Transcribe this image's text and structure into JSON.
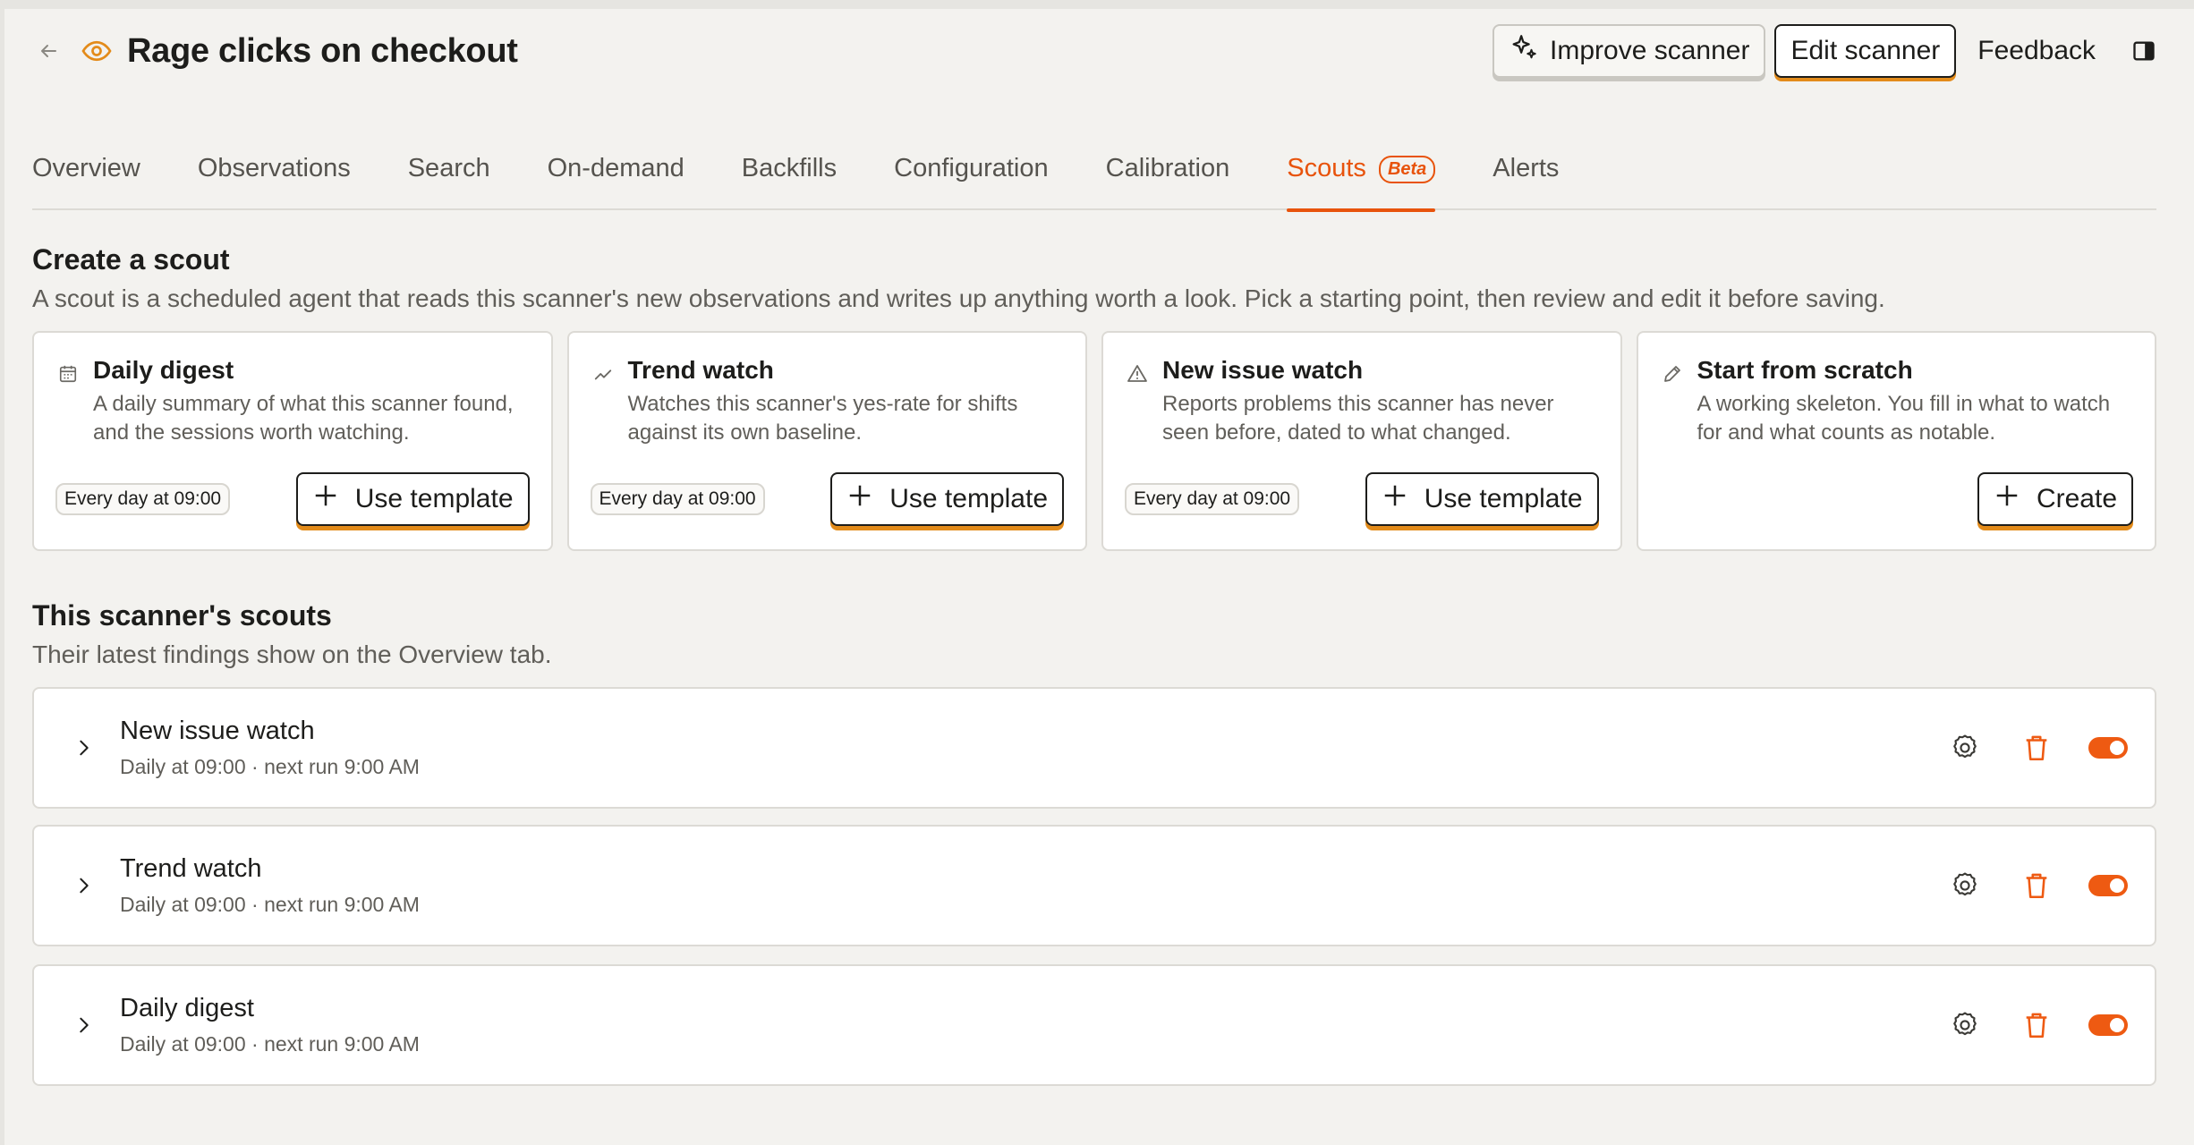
{
  "header": {
    "title": "Rage clicks on checkout",
    "improve_label": "Improve scanner",
    "edit_label": "Edit scanner",
    "feedback_label": "Feedback"
  },
  "tabs": [
    {
      "label": "Overview"
    },
    {
      "label": "Observations"
    },
    {
      "label": "Search"
    },
    {
      "label": "On-demand"
    },
    {
      "label": "Backfills"
    },
    {
      "label": "Configuration"
    },
    {
      "label": "Calibration"
    },
    {
      "label": "Scouts",
      "badge": "Beta",
      "active": true
    },
    {
      "label": "Alerts"
    }
  ],
  "create": {
    "title": "Create a scout",
    "description": "A scout is a scheduled agent that reads this scanner's new observations and writes up anything worth a look. Pick a starting point, then review and edit it before saving.",
    "templates": [
      {
        "icon": "calendar-icon",
        "title": "Daily digest",
        "desc": "A daily summary of what this scanner found, and the sessions worth watching.",
        "schedule": "Every day at 09:00",
        "button": "Use template"
      },
      {
        "icon": "trend-icon",
        "title": "Trend watch",
        "desc": "Watches this scanner's yes-rate for shifts against its own baseline.",
        "schedule": "Every day at 09:00",
        "button": "Use template"
      },
      {
        "icon": "warning-icon",
        "title": "New issue watch",
        "desc": "Reports problems this scanner has never seen before, dated to what changed.",
        "schedule": "Every day at 09:00",
        "button": "Use template"
      },
      {
        "icon": "pencil-icon",
        "title": "Start from scratch",
        "desc": "A working skeleton. You fill in what to watch for and what counts as notable.",
        "button": "Create"
      }
    ]
  },
  "scouts": {
    "title": "This scanner's scouts",
    "description": "Their latest findings show on the Overview tab.",
    "items": [
      {
        "name": "New issue watch",
        "meta": "Daily at 09:00 · next run 9:00 AM",
        "enabled": true
      },
      {
        "name": "Trend watch",
        "meta": "Daily at 09:00 · next run 9:00 AM",
        "enabled": true
      },
      {
        "name": "Daily digest",
        "meta": "Daily at 09:00 · next run 9:00 AM",
        "enabled": true
      }
    ]
  },
  "colors": {
    "accent": "#e8530c",
    "button_shadow": "#e38b1a"
  }
}
